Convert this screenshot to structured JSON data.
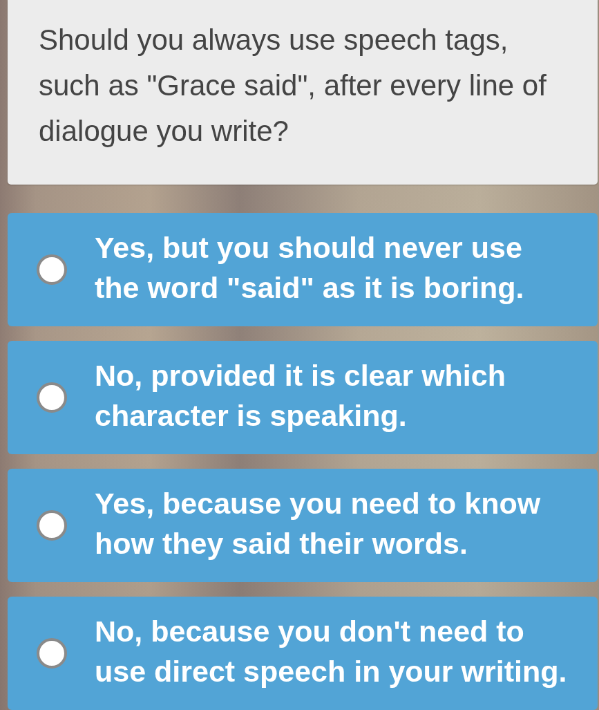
{
  "question": {
    "text": "Should you always use speech tags, such as \"Grace said\", after every line of dialogue you write?"
  },
  "options": [
    {
      "text": "Yes, but you should never use the word \"said\" as it is boring.",
      "selected": false
    },
    {
      "text": "No, provided it is clear which character is speaking.",
      "selected": false
    },
    {
      "text": "Yes, because you need to know how they said their words.",
      "selected": false
    },
    {
      "text": "No, because you don't need to use direct speech in your writing.",
      "selected": false
    }
  ]
}
